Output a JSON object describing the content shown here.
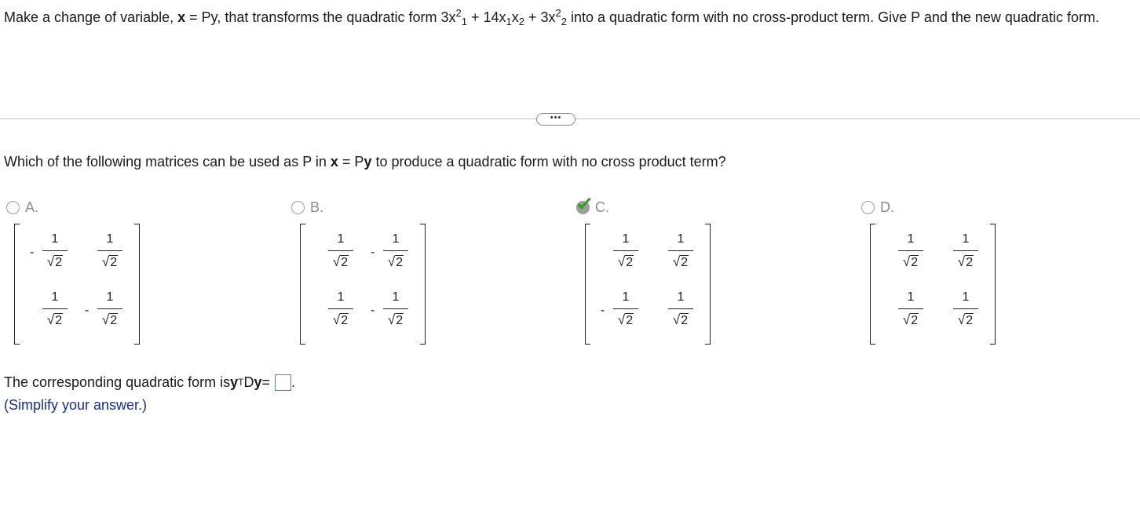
{
  "question": {
    "intro": "Make a change of variable, ",
    "x_bold": "x",
    "eq_text": " = Py",
    "after_eq": ", that transforms the quadratic form 3x",
    "sup1": "2",
    "sub1": "1",
    "mid1": " + 14x",
    "sub2": "1",
    "mid2": "x",
    "sub3": "2",
    "mid3": " + 3x",
    "sup4": "2",
    "sub4": "2",
    "tail": " into a quadratic form with no cross-product term. Give P and the new quadratic form."
  },
  "more_button": "•••",
  "subquestion": {
    "pre": "Which of the following matrices can be used as P in ",
    "x_bold": "x",
    "eq": " = P",
    "y_bold": "y",
    "post": " to produce a quadratic form with no cross product term?"
  },
  "options": [
    {
      "label": "A.",
      "selected": false,
      "correct": false,
      "signs": [
        "-",
        "",
        "",
        "-"
      ]
    },
    {
      "label": "B.",
      "selected": false,
      "correct": false,
      "signs": [
        "",
        "-",
        "",
        "-"
      ]
    },
    {
      "label": "C.",
      "selected": true,
      "correct": true,
      "signs": [
        "",
        "",
        "-",
        ""
      ]
    },
    {
      "label": "D.",
      "selected": false,
      "correct": false,
      "signs": [
        "",
        "",
        "",
        ""
      ]
    }
  ],
  "fraction": {
    "numerator": "1",
    "radical": "√",
    "radicand": "2"
  },
  "answer": {
    "pre": "The corresponding quadratic form is ",
    "y_bold": "y",
    "sup": "T",
    "mid": "D",
    "y_bold2": "y",
    "eq": " = ",
    "value": "",
    "period": "."
  },
  "hint": "(Simplify your answer.)",
  "colors": {
    "check": "#3a9a2a",
    "hint": "#1a2e8a",
    "answer_box_border": "#5b7fb5"
  }
}
